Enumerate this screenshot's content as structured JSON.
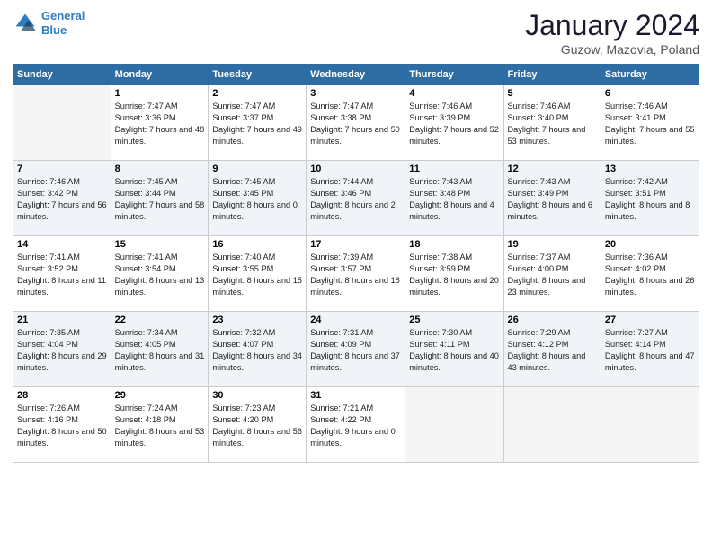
{
  "logo": {
    "line1": "General",
    "line2": "Blue"
  },
  "title": "January 2024",
  "subtitle": "Guzow, Mazovia, Poland",
  "weekdays": [
    "Sunday",
    "Monday",
    "Tuesday",
    "Wednesday",
    "Thursday",
    "Friday",
    "Saturday"
  ],
  "weeks": [
    [
      {
        "num": "",
        "sunrise": "",
        "sunset": "",
        "daylight": ""
      },
      {
        "num": "1",
        "sunrise": "Sunrise: 7:47 AM",
        "sunset": "Sunset: 3:36 PM",
        "daylight": "Daylight: 7 hours and 48 minutes."
      },
      {
        "num": "2",
        "sunrise": "Sunrise: 7:47 AM",
        "sunset": "Sunset: 3:37 PM",
        "daylight": "Daylight: 7 hours and 49 minutes."
      },
      {
        "num": "3",
        "sunrise": "Sunrise: 7:47 AM",
        "sunset": "Sunset: 3:38 PM",
        "daylight": "Daylight: 7 hours and 50 minutes."
      },
      {
        "num": "4",
        "sunrise": "Sunrise: 7:46 AM",
        "sunset": "Sunset: 3:39 PM",
        "daylight": "Daylight: 7 hours and 52 minutes."
      },
      {
        "num": "5",
        "sunrise": "Sunrise: 7:46 AM",
        "sunset": "Sunset: 3:40 PM",
        "daylight": "Daylight: 7 hours and 53 minutes."
      },
      {
        "num": "6",
        "sunrise": "Sunrise: 7:46 AM",
        "sunset": "Sunset: 3:41 PM",
        "daylight": "Daylight: 7 hours and 55 minutes."
      }
    ],
    [
      {
        "num": "7",
        "sunrise": "Sunrise: 7:46 AM",
        "sunset": "Sunset: 3:42 PM",
        "daylight": "Daylight: 7 hours and 56 minutes."
      },
      {
        "num": "8",
        "sunrise": "Sunrise: 7:45 AM",
        "sunset": "Sunset: 3:44 PM",
        "daylight": "Daylight: 7 hours and 58 minutes."
      },
      {
        "num": "9",
        "sunrise": "Sunrise: 7:45 AM",
        "sunset": "Sunset: 3:45 PM",
        "daylight": "Daylight: 8 hours and 0 minutes."
      },
      {
        "num": "10",
        "sunrise": "Sunrise: 7:44 AM",
        "sunset": "Sunset: 3:46 PM",
        "daylight": "Daylight: 8 hours and 2 minutes."
      },
      {
        "num": "11",
        "sunrise": "Sunrise: 7:43 AM",
        "sunset": "Sunset: 3:48 PM",
        "daylight": "Daylight: 8 hours and 4 minutes."
      },
      {
        "num": "12",
        "sunrise": "Sunrise: 7:43 AM",
        "sunset": "Sunset: 3:49 PM",
        "daylight": "Daylight: 8 hours and 6 minutes."
      },
      {
        "num": "13",
        "sunrise": "Sunrise: 7:42 AM",
        "sunset": "Sunset: 3:51 PM",
        "daylight": "Daylight: 8 hours and 8 minutes."
      }
    ],
    [
      {
        "num": "14",
        "sunrise": "Sunrise: 7:41 AM",
        "sunset": "Sunset: 3:52 PM",
        "daylight": "Daylight: 8 hours and 11 minutes."
      },
      {
        "num": "15",
        "sunrise": "Sunrise: 7:41 AM",
        "sunset": "Sunset: 3:54 PM",
        "daylight": "Daylight: 8 hours and 13 minutes."
      },
      {
        "num": "16",
        "sunrise": "Sunrise: 7:40 AM",
        "sunset": "Sunset: 3:55 PM",
        "daylight": "Daylight: 8 hours and 15 minutes."
      },
      {
        "num": "17",
        "sunrise": "Sunrise: 7:39 AM",
        "sunset": "Sunset: 3:57 PM",
        "daylight": "Daylight: 8 hours and 18 minutes."
      },
      {
        "num": "18",
        "sunrise": "Sunrise: 7:38 AM",
        "sunset": "Sunset: 3:59 PM",
        "daylight": "Daylight: 8 hours and 20 minutes."
      },
      {
        "num": "19",
        "sunrise": "Sunrise: 7:37 AM",
        "sunset": "Sunset: 4:00 PM",
        "daylight": "Daylight: 8 hours and 23 minutes."
      },
      {
        "num": "20",
        "sunrise": "Sunrise: 7:36 AM",
        "sunset": "Sunset: 4:02 PM",
        "daylight": "Daylight: 8 hours and 26 minutes."
      }
    ],
    [
      {
        "num": "21",
        "sunrise": "Sunrise: 7:35 AM",
        "sunset": "Sunset: 4:04 PM",
        "daylight": "Daylight: 8 hours and 29 minutes."
      },
      {
        "num": "22",
        "sunrise": "Sunrise: 7:34 AM",
        "sunset": "Sunset: 4:05 PM",
        "daylight": "Daylight: 8 hours and 31 minutes."
      },
      {
        "num": "23",
        "sunrise": "Sunrise: 7:32 AM",
        "sunset": "Sunset: 4:07 PM",
        "daylight": "Daylight: 8 hours and 34 minutes."
      },
      {
        "num": "24",
        "sunrise": "Sunrise: 7:31 AM",
        "sunset": "Sunset: 4:09 PM",
        "daylight": "Daylight: 8 hours and 37 minutes."
      },
      {
        "num": "25",
        "sunrise": "Sunrise: 7:30 AM",
        "sunset": "Sunset: 4:11 PM",
        "daylight": "Daylight: 8 hours and 40 minutes."
      },
      {
        "num": "26",
        "sunrise": "Sunrise: 7:29 AM",
        "sunset": "Sunset: 4:12 PM",
        "daylight": "Daylight: 8 hours and 43 minutes."
      },
      {
        "num": "27",
        "sunrise": "Sunrise: 7:27 AM",
        "sunset": "Sunset: 4:14 PM",
        "daylight": "Daylight: 8 hours and 47 minutes."
      }
    ],
    [
      {
        "num": "28",
        "sunrise": "Sunrise: 7:26 AM",
        "sunset": "Sunset: 4:16 PM",
        "daylight": "Daylight: 8 hours and 50 minutes."
      },
      {
        "num": "29",
        "sunrise": "Sunrise: 7:24 AM",
        "sunset": "Sunset: 4:18 PM",
        "daylight": "Daylight: 8 hours and 53 minutes."
      },
      {
        "num": "30",
        "sunrise": "Sunrise: 7:23 AM",
        "sunset": "Sunset: 4:20 PM",
        "daylight": "Daylight: 8 hours and 56 minutes."
      },
      {
        "num": "31",
        "sunrise": "Sunrise: 7:21 AM",
        "sunset": "Sunset: 4:22 PM",
        "daylight": "Daylight: 9 hours and 0 minutes."
      },
      {
        "num": "",
        "sunrise": "",
        "sunset": "",
        "daylight": ""
      },
      {
        "num": "",
        "sunrise": "",
        "sunset": "",
        "daylight": ""
      },
      {
        "num": "",
        "sunrise": "",
        "sunset": "",
        "daylight": ""
      }
    ]
  ]
}
